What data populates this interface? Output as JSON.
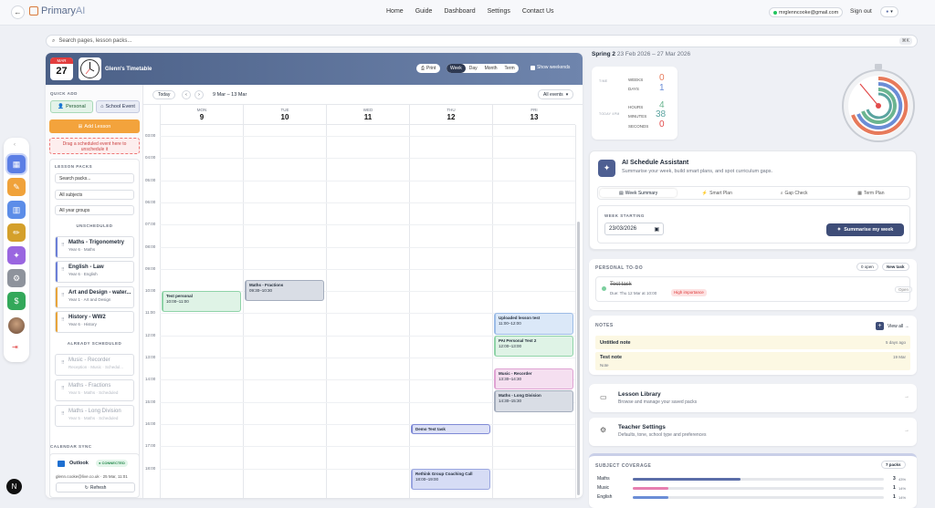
{
  "app": {
    "logo_a": "Primary",
    "logo_b": "AI"
  },
  "nav": {
    "links": [
      "Home",
      "Guide",
      "Dashboard",
      "Settings",
      "Contact Us"
    ],
    "email": "mrglenncooke@gmail.com",
    "signout": "Sign out"
  },
  "search": {
    "placeholder": "Search pages, lesson packs...",
    "kbd": "⌘K"
  },
  "cal": {
    "month": "MAR",
    "day": "27",
    "title": "Glenn's Timetable",
    "print": "Print",
    "views": [
      "Week",
      "Day",
      "Month",
      "Term"
    ],
    "show_weekends": "Show weekends",
    "today": "Today",
    "range": "9 Mar – 13 Mar",
    "all_events": "All events",
    "days": [
      {
        "n": "MON",
        "d": "9"
      },
      {
        "n": "TUE",
        "d": "10"
      },
      {
        "n": "WED",
        "d": "11"
      },
      {
        "n": "THU",
        "d": "12"
      },
      {
        "n": "FRI",
        "d": "13"
      }
    ],
    "hours": [
      "03:00",
      "04:00",
      "05:00",
      "06:00",
      "07:00",
      "08:00",
      "09:00",
      "10:00",
      "11:00",
      "12:00",
      "13:00",
      "14:00",
      "15:00",
      "16:00",
      "17:00",
      "18:00"
    ],
    "events": [
      {
        "day": 0,
        "start": 10.0,
        "end": 11.0,
        "title": "Test personal",
        "time": "10:00–11:00",
        "bg": "#dff3e6",
        "border": "#8fd3a8"
      },
      {
        "day": 1,
        "start": 9.5,
        "end": 10.5,
        "title": "Maths - Fractions",
        "time": "09:30–10:30",
        "bg": "#d9dde5",
        "border": "#a4adbd"
      },
      {
        "day": 4,
        "start": 11.0,
        "end": 12.0,
        "title": "Uploaded lesson test",
        "time": "11:00–12:00",
        "bg": "#dbe8f8",
        "border": "#9cbce6"
      },
      {
        "day": 4,
        "start": 12.0,
        "end": 13.0,
        "title": "PAI Personal Test 2",
        "time": "12:00–13:00",
        "bg": "#dff3e6",
        "border": "#8fd3a8"
      },
      {
        "day": 4,
        "start": 13.5,
        "end": 14.5,
        "title": "Music - Recorder",
        "time": "13:30–14:30",
        "bg": "#f5dff0",
        "border": "#dfa3d3"
      },
      {
        "day": 4,
        "start": 14.5,
        "end": 15.5,
        "title": "Maths - Long Division",
        "time": "14:30–15:30",
        "bg": "#d9dde5",
        "border": "#a4adbd"
      },
      {
        "day": 3,
        "start": 16.0,
        "end": 16.5,
        "title": "Demo Test task",
        "time": "16:00–16:30",
        "bg": "#dde1f7",
        "border": "#7f8ad6"
      },
      {
        "day": 3,
        "start": 18.0,
        "end": 19.0,
        "title": "Rethink Group Coaching Call",
        "time": "18:00–19:00",
        "bg": "#d6dcf5",
        "border": "#9aa6e0"
      }
    ]
  },
  "side": {
    "quick_add": "QUICK ADD",
    "personal": "Personal",
    "school_event": "School Event",
    "add_lesson": "Add Lesson",
    "drag_hint": "Drag a scheduled event here to unschedule it",
    "lesson_packs": "LESSON PACKS",
    "search_packs": "Search packs...",
    "all_subjects": "All subjects",
    "all_years": "All year groups",
    "unscheduled": "UNSCHEDULED",
    "packs": [
      {
        "t": "Maths - Trigonometry",
        "s": "Year 6 · Maths",
        "c": "#6b7fd7"
      },
      {
        "t": "English - Law",
        "s": "Year 6 · English",
        "c": "#6b7fd7"
      },
      {
        "t": "Art and Design - water...",
        "s": "Year 1 · Art and Design",
        "c": "#e7a43a"
      },
      {
        "t": "History - WW2",
        "s": "Year 6 · History",
        "c": "#e7a43a"
      }
    ],
    "already": "ALREADY SCHEDULED",
    "scheduled": [
      {
        "t": "Music - Recorder",
        "s": "Reception · Music · Schedul..."
      },
      {
        "t": "Maths - Fractions",
        "s": "Year 5 · Maths · Scheduled"
      },
      {
        "t": "Maths - Long Division",
        "s": "Year 5 · Maths · Scheduled"
      }
    ],
    "cal_sync": "CALENDAR SYNC",
    "outlook": "Outlook",
    "connected": "CONNECTED",
    "sync_info": "glenn.cooke@live.co.uk · 25 Mar, 11:01",
    "refresh": "Refresh"
  },
  "term": {
    "name": "Spring 2",
    "dates": "23 Feb 2026 – 27 Mar 2026",
    "time_lbl": "TIME",
    "today_lbl": "TODAY 4PM",
    "weeks": "0",
    "days": "1",
    "hours": "4",
    "minutes": "38",
    "seconds": "0",
    "weeks_lbl": "WEEKS",
    "days_lbl": "DAYS",
    "hours_lbl": "HOURS",
    "minutes_lbl": "MINUTES",
    "seconds_lbl": "SECONDS"
  },
  "ai": {
    "title": "AI Schedule Assistant",
    "sub": "Summarise your week, build smart plans, and spot curriculum gaps.",
    "tabs": [
      "Week Summary",
      "Smart Plan",
      "Gap Check",
      "Term Plan"
    ],
    "week_lbl": "WEEK STARTING",
    "date": "23/03/2026",
    "btn": "Summarise my week"
  },
  "todo": {
    "title": "PERSONAL TO-DO",
    "open": "0 open",
    "newtask": "New task",
    "task": "Test task",
    "due": "Due: Thu 12 Mar at 10:00",
    "imp": "High importance",
    "status": "Open"
  },
  "notes": {
    "title": "NOTES",
    "viewall": "View all →",
    "items": [
      {
        "t": "Untitled note",
        "s": "",
        "when": "5 days ago"
      },
      {
        "t": "Test note",
        "s": "Note",
        "when": "19 Mar"
      }
    ]
  },
  "library": {
    "title": "Lesson Library",
    "sub": "Browse and manage your saved packs"
  },
  "settings": {
    "title": "Teacher Settings",
    "sub": "Defaults, tone, school type and preferences"
  },
  "coverage": {
    "title": "SUBJECT COVERAGE",
    "packs": "7 packs",
    "rows": [
      {
        "s": "Maths",
        "n": "3",
        "p": "43%",
        "f": 0.43,
        "c": "#5b6ea8"
      },
      {
        "s": "Music",
        "n": "1",
        "p": "14%",
        "f": 0.14,
        "c": "#e77fb0"
      },
      {
        "s": "English",
        "n": "1",
        "p": "14%",
        "f": 0.14,
        "c": "#6b8dd6"
      }
    ]
  }
}
